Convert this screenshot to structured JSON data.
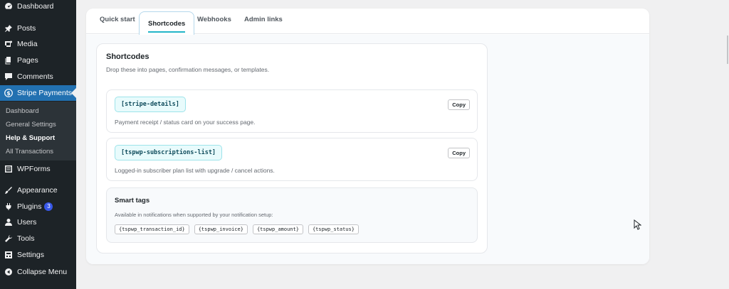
{
  "sidebar": {
    "items": [
      {
        "label": "Dashboard",
        "icon": "dashboard-icon"
      },
      {
        "label": "Posts",
        "icon": "pin-icon"
      },
      {
        "label": "Media",
        "icon": "media-icon"
      },
      {
        "label": "Pages",
        "icon": "pages-icon"
      },
      {
        "label": "Comments",
        "icon": "comment-icon"
      },
      {
        "label": "Stripe Payments",
        "icon": "dollar-icon"
      },
      {
        "label": "WPForms",
        "icon": "forms-icon"
      },
      {
        "label": "Appearance",
        "icon": "brush-icon"
      },
      {
        "label": "Plugins",
        "icon": "plug-icon",
        "badge": "3"
      },
      {
        "label": "Users",
        "icon": "user-icon"
      },
      {
        "label": "Tools",
        "icon": "wrench-icon"
      },
      {
        "label": "Settings",
        "icon": "settings-icon"
      },
      {
        "label": "Collapse Menu",
        "icon": "collapse-icon"
      }
    ],
    "submenu": [
      "Dashboard",
      "General Settings",
      "Help & Support",
      "All Transactions"
    ]
  },
  "tabs": [
    "Quick start",
    "Shortcodes",
    "Webhooks",
    "Admin links"
  ],
  "shortcodes": {
    "title": "Shortcodes",
    "description": "Drop these into pages, confirmation messages, or templates.",
    "items": [
      {
        "code": "[stripe-details]",
        "description": "Payment receipt / status card on your success page.",
        "copy_label": "Copy"
      },
      {
        "code": "[tspwp-subscriptions-list]",
        "description": "Logged-in subscriber plan list with upgrade / cancel actions.",
        "copy_label": "Copy"
      }
    ]
  },
  "smart_tags": {
    "title": "Smart tags",
    "description": "Available in notifications when supported by your notification setup:",
    "tags": [
      "{tspwp_transaction_id}",
      "{tspwp_invoice}",
      "{tspwp_amount}",
      "{tspwp_status}"
    ]
  },
  "colors": {
    "sidebar_bg": "#1d2327",
    "active_menu": "#2271b1",
    "accent": "#22b5c8",
    "badge": "#3858e9"
  }
}
